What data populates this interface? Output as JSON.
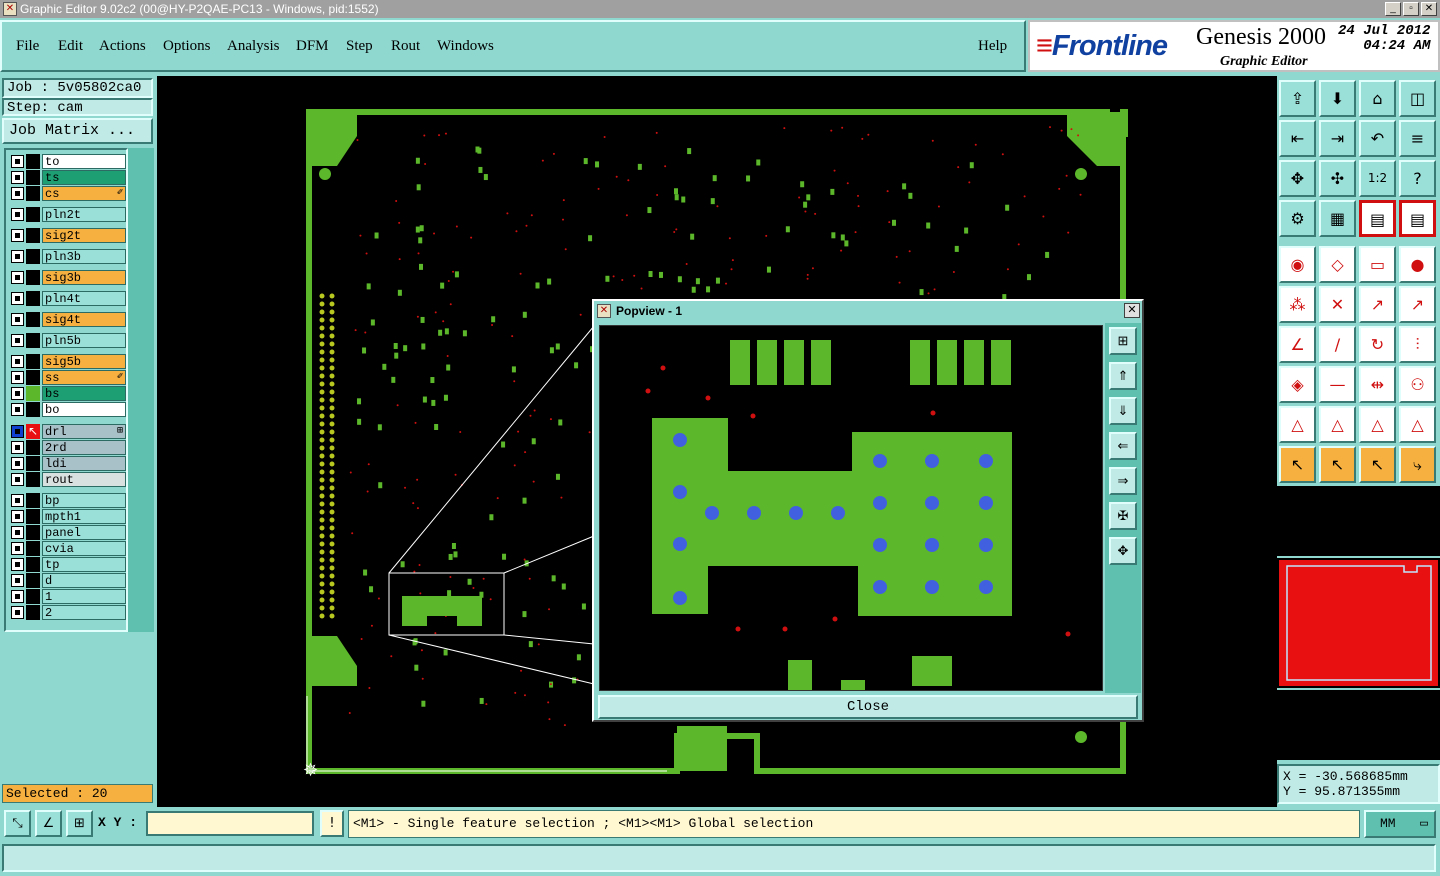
{
  "window": {
    "title": "Graphic Editor 9.02c2 (00@HY-P2QAE-PC13 - Windows, pid:1552)",
    "app_icon": "x-window-icon"
  },
  "menu": {
    "items": [
      "File",
      "Edit",
      "Actions",
      "Options",
      "Analysis",
      "DFM",
      "Step",
      "Rout",
      "Windows"
    ],
    "help": "Help"
  },
  "brand": {
    "logo": "Frontline",
    "product": "Genesis 2000",
    "subtitle": "Graphic Editor",
    "date": "24 Jul 2012",
    "time": "04:24 AM"
  },
  "job": {
    "job_label": "Job : 5v05802ca0",
    "step_label": "Step: cam",
    "matrix_button": "Job Matrix ..."
  },
  "layers": [
    {
      "name": "to",
      "color": "#ffffff"
    },
    {
      "name": "ts",
      "color": "#1d9e73"
    },
    {
      "name": "cs",
      "color": "#f5b040",
      "flag": "✐"
    },
    {
      "name": "pln2t",
      "color": "#9be0d8"
    },
    {
      "name": "sig2t",
      "color": "#f5b040"
    },
    {
      "name": "pln3b",
      "color": "#9be0d8"
    },
    {
      "name": "sig3b",
      "color": "#f5b040"
    },
    {
      "name": "pln4t",
      "color": "#9be0d8"
    },
    {
      "name": "sig4t",
      "color": "#f5b040"
    },
    {
      "name": "pln5b",
      "color": "#9be0d8"
    },
    {
      "name": "sig5b",
      "color": "#f5b040"
    },
    {
      "name": "ss",
      "color": "#f5b040",
      "flag": "✐"
    },
    {
      "name": "bs",
      "color": "#1d9e73",
      "active_color": "#5cb82a"
    },
    {
      "name": "bo",
      "color": "#ffffff"
    },
    {
      "name": "drl",
      "color": "#a8c0c8",
      "flag": "⊞",
      "work": true
    },
    {
      "name": "2rd",
      "color": "#a8c0c8"
    },
    {
      "name": "ldi",
      "color": "#a8c0c8"
    },
    {
      "name": "rout",
      "color": "#d8e0e0"
    },
    {
      "name": "bp",
      "color": "#9be0d8"
    },
    {
      "name": "mpth1",
      "color": "#9be0d8"
    },
    {
      "name": "panel",
      "color": "#9be0d8"
    },
    {
      "name": "cvia",
      "color": "#9be0d8"
    },
    {
      "name": "tp",
      "color": "#9be0d8"
    },
    {
      "name": "d",
      "color": "#9be0d8"
    },
    {
      "name": "1",
      "color": "#9be0d8"
    },
    {
      "name": "2",
      "color": "#9be0d8"
    }
  ],
  "selected": "Selected : 20",
  "popview": {
    "title": "Popview - 1",
    "close": "Close"
  },
  "coords": {
    "x": "X = -30.568685mm",
    "y": "Y = 95.871355mm"
  },
  "status": {
    "xy_label": "X Y :",
    "xy_value": "",
    "hint": "<M1> - Single feature selection ; <M1><M1> Global selection",
    "units": "MM",
    "info_icon": "!"
  },
  "colors": {
    "board": "#5cb82a",
    "pad": "#5cb82a",
    "drill": "#4060e0",
    "via": "#d01010",
    "background": "#000000",
    "panel_teal": "#8fd8d0"
  },
  "tools": [
    "zoom-home-icon",
    "zoom-select-icon",
    "home-icon",
    "split-view-icon",
    "pan-left-icon",
    "pan-right-icon",
    "undo-view-icon",
    "redraw-icon",
    "fit-icon",
    "center-icon",
    "scale-1-2-icon",
    "help-icon",
    "snap-icon",
    "grid-icon",
    "layer-color-icon",
    "layer-color2-icon",
    "add-pad-icon",
    "add-line-icon",
    "measure-icon",
    "dot-icon",
    "connect-icon",
    "cross-icon",
    "move-icon",
    "move2-icon",
    "angle-icon",
    "line-icon",
    "arc-icon",
    "break-icon",
    "node-icon",
    "minus-icon",
    "dim-icon",
    "circle-icon",
    "tri-icon",
    "tri2-icon",
    "tri3-icon",
    "tri4-icon",
    "select-icon",
    "select2-icon",
    "select3-icon",
    "select-net-icon"
  ]
}
